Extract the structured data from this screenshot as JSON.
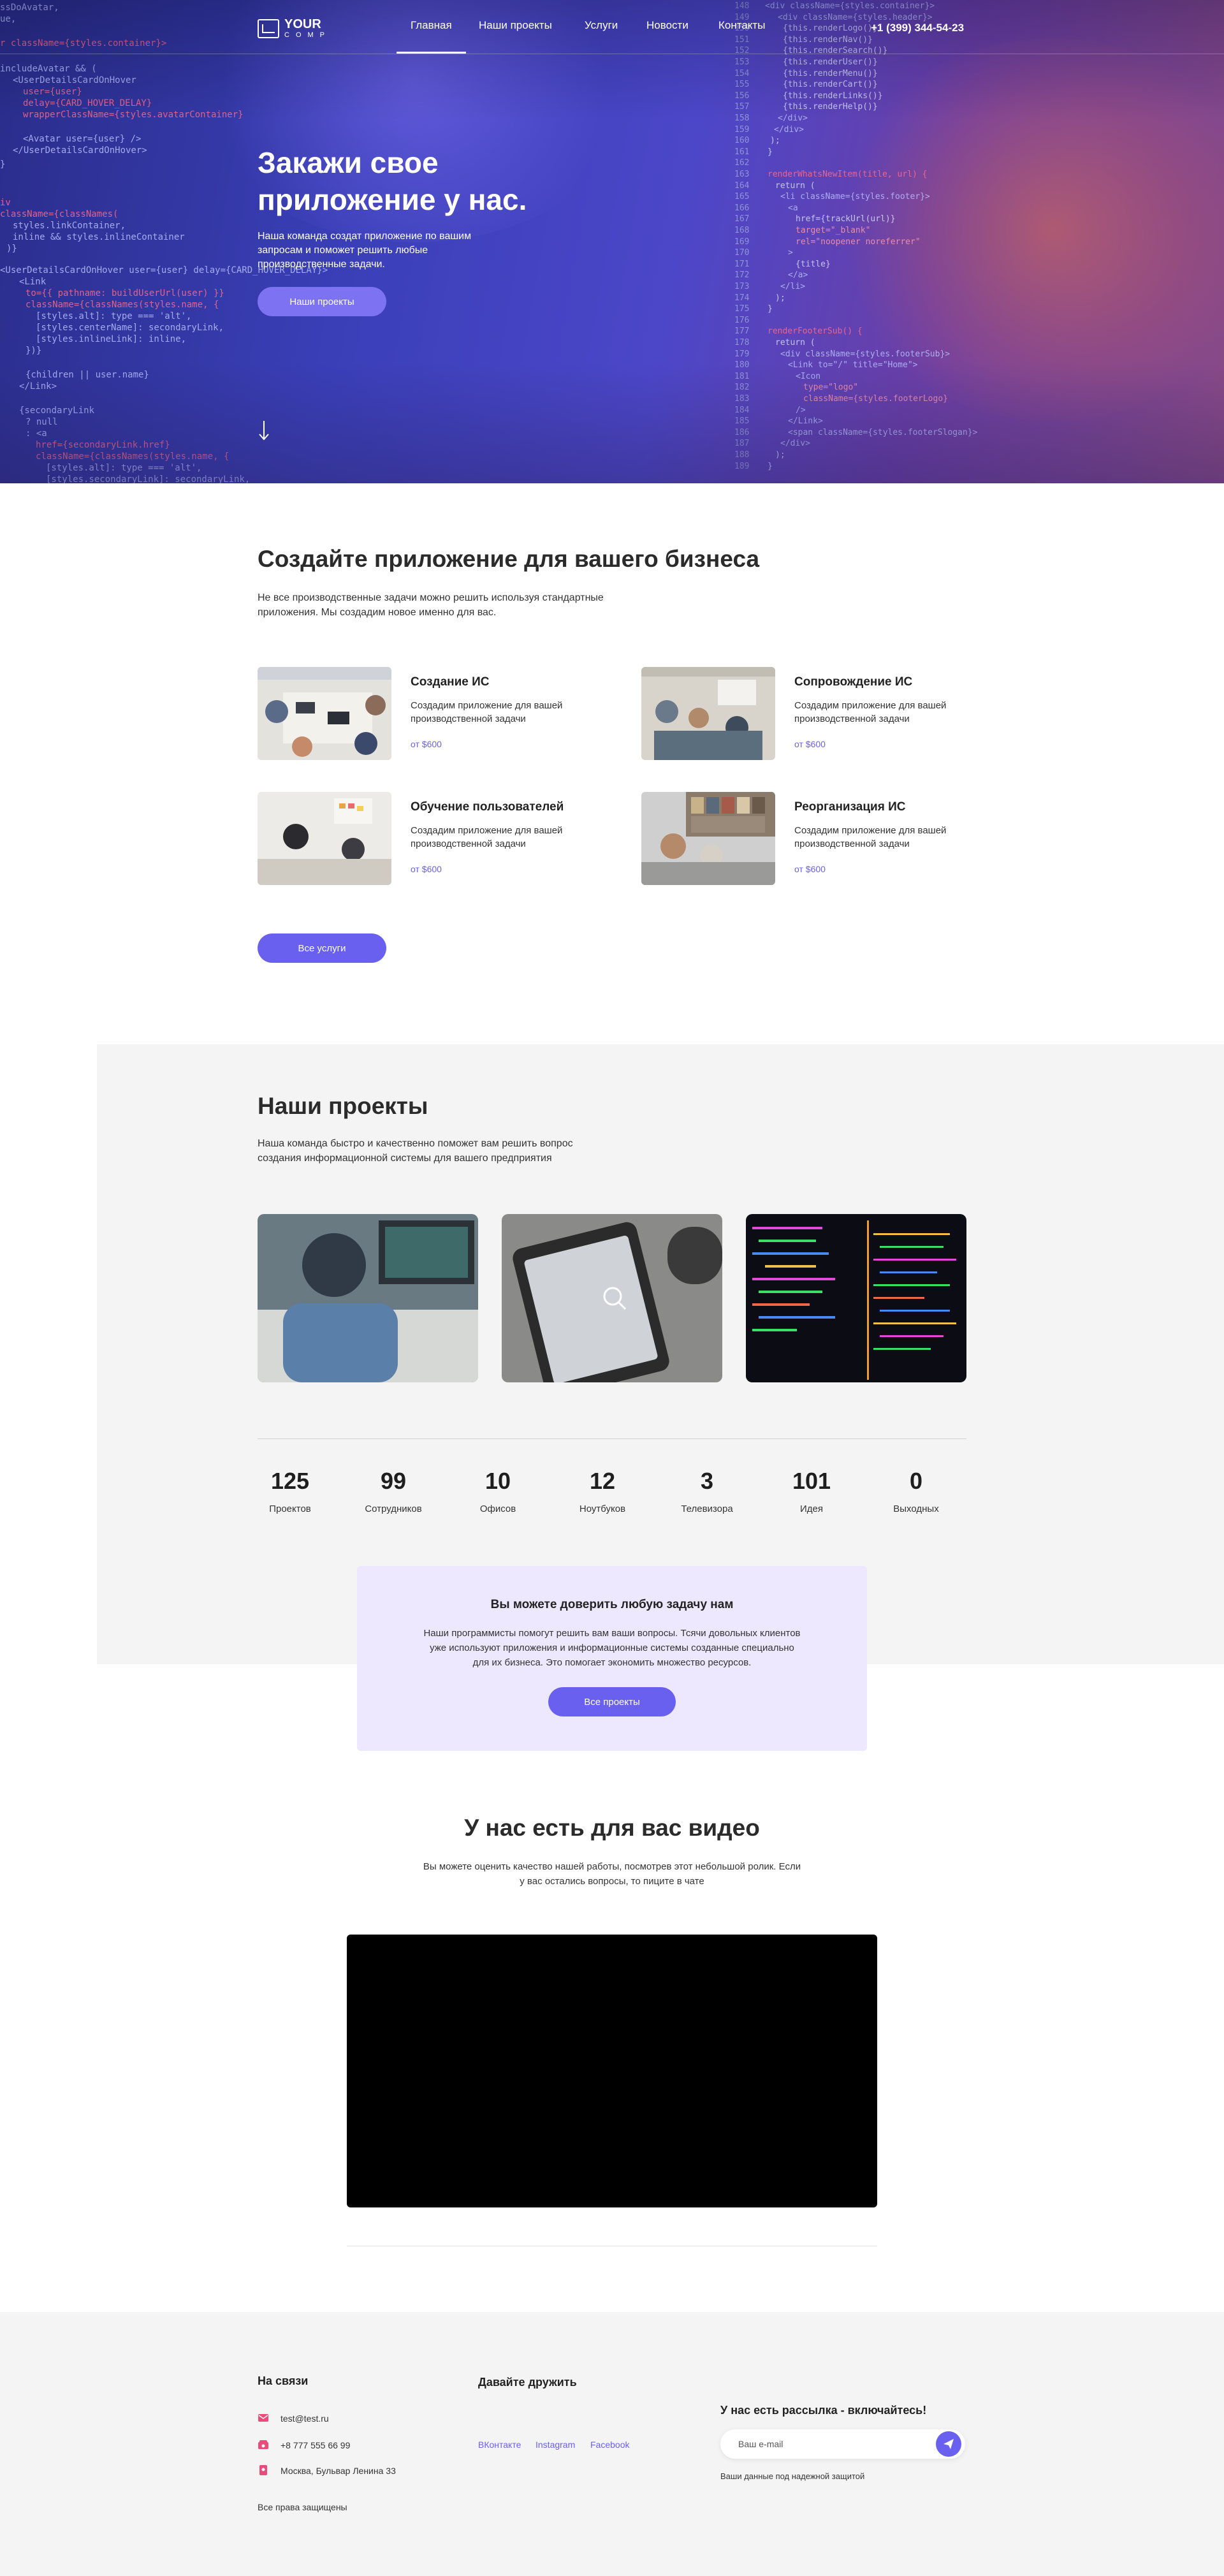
{
  "brand": {
    "logo_line1": "YOUR",
    "logo_line2": "COMP"
  },
  "nav": {
    "items": [
      "Главная",
      "Наши проекты",
      "Услуги",
      "Новости",
      "Контакты"
    ],
    "phone": "+1 (399) 344-54-23"
  },
  "hero": {
    "title": "Закажи свое приложение у нас.",
    "subtitle": "Наша команда создат приложение по вашим запросам и поможет решить любые производственные задачи.",
    "button": "Наши проекты"
  },
  "services": {
    "title": "Создайте приложение для вашего бизнеса",
    "text": "Не все производственные задачи можно решить используя стандартные приложения. Мы создадим новое именно для вас.",
    "items": [
      {
        "title": "Создание ИС",
        "desc": "Создадим приложение для вашей производственной задачи",
        "price": "от $600"
      },
      {
        "title": "Сопровождение ИС",
        "desc": "Создадим приложение для вашей производственной задачи",
        "price": "от $600"
      },
      {
        "title": "Обучение пользователей",
        "desc": "Создадим приложение для вашей производственной задачи",
        "price": "от $600"
      },
      {
        "title": "Реорганизация ИС",
        "desc": "Создадим приложение для вашей производственной задачи",
        "price": "от $600"
      }
    ],
    "button": "Все услуги"
  },
  "projects": {
    "title": "Наши проекты",
    "text": "Наша команда быстро и качественно поможет вам решить вопрос создания информационной системы для вашего предприятия",
    "stats": [
      {
        "value": "125",
        "label": "Проектов"
      },
      {
        "value": "99",
        "label": "Сотрудников"
      },
      {
        "value": "10",
        "label": "Офисов"
      },
      {
        "value": "12",
        "label": "Ноутбуков"
      },
      {
        "value": "3",
        "label": "Телевизора"
      },
      {
        "value": "101",
        "label": "Идея"
      },
      {
        "value": "0",
        "label": "Выходных"
      }
    ]
  },
  "cta": {
    "title": "Вы можете доверить любую задачу нам",
    "text": "Наши программисты помогут решить вам ваши вопросы. Тсячи довольных клиентов уже используют приложения и информационные системы созданные специально для их бизнеса. Это помогает экономить множество ресурсов.",
    "button": "Все проекты"
  },
  "video": {
    "title": "У нас есть для вас видео",
    "text": "Вы можете оценить качество нашей работы, посмотрев этот небольшой ролик. Если у вас остались вопросы, то пиците в чате"
  },
  "footer": {
    "contacts_title": "На связи",
    "email": "test@test.ru",
    "phone": "+8 777 555 66 99",
    "address": "Москва, Бульвар Ленина 33",
    "rights": "Все права защищены",
    "social_title": "Давайте дружить",
    "social": [
      "ВКонтакте",
      "Instagram",
      "Facebook"
    ],
    "newsletter_title": "У нас есть рассылка - включайтесь!",
    "email_placeholder": "Ваш e-mail",
    "privacy": "Ваши данные под надежной защитой"
  },
  "colors": {
    "accent": "#6a60f0",
    "hero_start": "#2a2d8a",
    "hero_end": "#8a4a86",
    "cta_bg": "#ede8fd",
    "section_bg": "#f4f4f5"
  }
}
